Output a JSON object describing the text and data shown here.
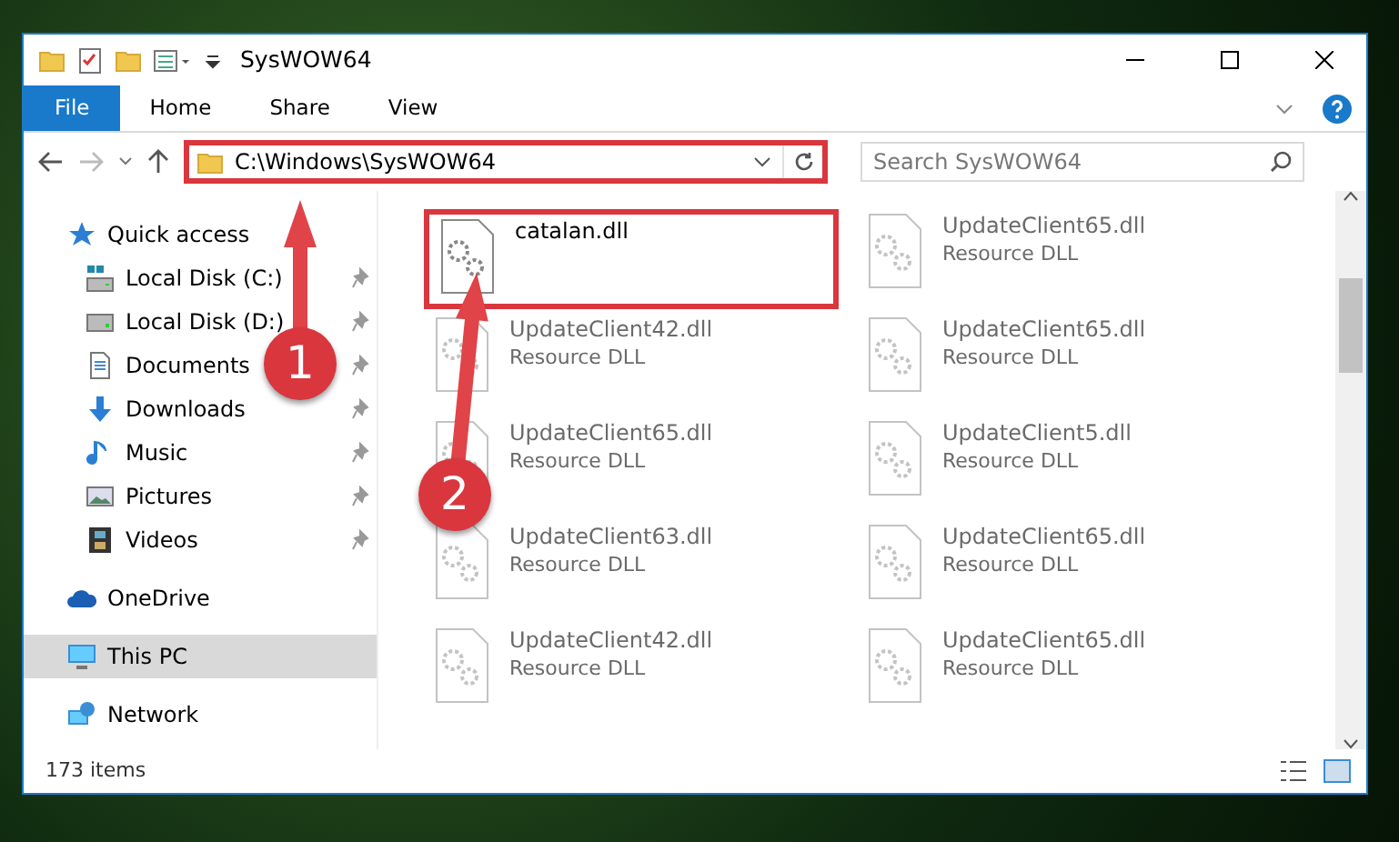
{
  "window": {
    "title": "SysWOW64"
  },
  "ribbon_tabs": [
    {
      "label": "File",
      "selected": true
    },
    {
      "label": "Home",
      "selected": false
    },
    {
      "label": "Share",
      "selected": false
    },
    {
      "label": "View",
      "selected": false
    }
  ],
  "address_bar": {
    "value": "C:\\Windows\\SysWOW64",
    "highlighted": true
  },
  "search": {
    "placeholder": "Search SysWOW64"
  },
  "sidebar": {
    "items": [
      {
        "label": "Quick access",
        "kind": "star",
        "selected": false,
        "children": [
          {
            "label": "Local Disk (C:)",
            "kind": "systemdrive",
            "pinned": true,
            "selected": false
          },
          {
            "label": "Local Disk (D:)",
            "kind": "drive",
            "pinned": true,
            "selected": false
          },
          {
            "label": "Documents",
            "kind": "document",
            "pinned": true,
            "selected": false
          },
          {
            "label": "Downloads",
            "kind": "download",
            "pinned": true,
            "selected": false
          },
          {
            "label": "Music",
            "kind": "music",
            "pinned": true,
            "selected": false
          },
          {
            "label": "Pictures",
            "kind": "picture",
            "pinned": true,
            "selected": false
          },
          {
            "label": "Videos",
            "kind": "video",
            "pinned": true,
            "selected": false
          }
        ]
      },
      {
        "label": "OneDrive",
        "kind": "cloud",
        "selected": false
      },
      {
        "label": "This PC",
        "kind": "computer",
        "selected": true
      },
      {
        "label": "Network",
        "kind": "network",
        "selected": false
      }
    ]
  },
  "files": [
    {
      "name": "catalan.dll",
      "highlighted": true,
      "blurred": false
    },
    {
      "name": "UpdateClient65.dll",
      "type": "Resource DLL",
      "highlighted": false,
      "blurred": true
    },
    {
      "name": "UpdateClient42.dll",
      "type": "Resource DLL",
      "highlighted": false,
      "blurred": true
    },
    {
      "name": "UpdateClient65.dll",
      "type": "Resource DLL",
      "highlighted": false,
      "blurred": true
    },
    {
      "name": "UpdateClient65.dll",
      "type": "Resource DLL",
      "highlighted": false,
      "blurred": true
    },
    {
      "name": "UpdateClient5.dll",
      "type": "Resource DLL",
      "highlighted": false,
      "blurred": true
    },
    {
      "name": "UpdateClient63.dll",
      "type": "Resource DLL",
      "highlighted": false,
      "blurred": true
    },
    {
      "name": "UpdateClient65.dll",
      "type": "Resource DLL",
      "highlighted": false,
      "blurred": true
    },
    {
      "name": "UpdateClient42.dll",
      "type": "Resource DLL",
      "highlighted": false,
      "blurred": true
    },
    {
      "name": "UpdateClient65.dll",
      "type": "Resource DLL",
      "highlighted": false,
      "blurred": true
    }
  ],
  "status_bar": {
    "item_count": "173 items"
  },
  "annotations": [
    {
      "number": "1"
    },
    {
      "number": "2"
    }
  ]
}
